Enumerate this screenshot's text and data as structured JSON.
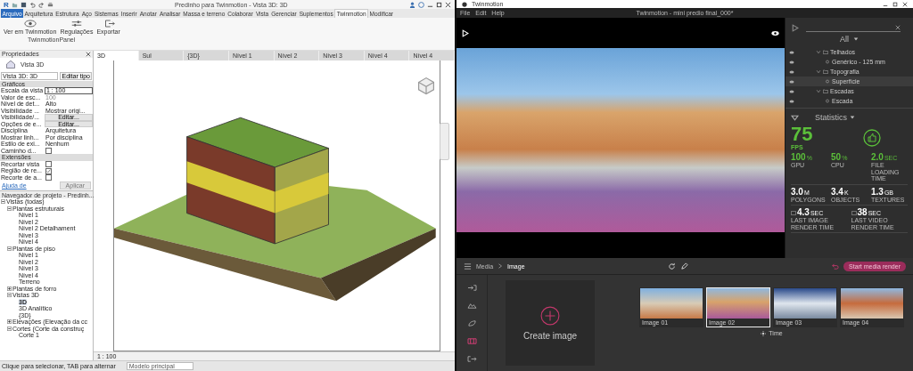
{
  "revit": {
    "logo": "R",
    "title": "Predinho para Twinmotion - Vista 3D: 3D",
    "ribbon_tabs": [
      {
        "label": "Arquivo",
        "kind": "application",
        "selected": false
      },
      {
        "label": "Arquitetura",
        "kind": "tab",
        "selected": false
      },
      {
        "label": "Estrutura",
        "kind": "tab",
        "selected": false
      },
      {
        "label": "Aço",
        "kind": "tab",
        "selected": false
      },
      {
        "label": "Sistemas",
        "kind": "tab",
        "selected": false
      },
      {
        "label": "Inserir",
        "kind": "tab",
        "selected": false
      },
      {
        "label": "Anotar",
        "kind": "tab",
        "selected": false
      },
      {
        "label": "Analisar",
        "kind": "tab",
        "selected": false
      },
      {
        "label": "Massa e terreno",
        "kind": "tab",
        "selected": false
      },
      {
        "label": "Colaborar",
        "kind": "tab",
        "selected": false
      },
      {
        "label": "Vista",
        "kind": "tab",
        "selected": false
      },
      {
        "label": "Gerenciar",
        "kind": "tab",
        "selected": false
      },
      {
        "label": "Suplementos",
        "kind": "tab",
        "selected": false
      },
      {
        "label": "Twinmotion",
        "kind": "tab",
        "selected": true
      },
      {
        "label": "Modificar",
        "kind": "tab",
        "selected": false
      }
    ],
    "ribbon_buttons": [
      {
        "label": "Ver em Twinmotion",
        "kind": "view"
      },
      {
        "label": "Regulações",
        "kind": "settings"
      },
      {
        "label": "Exportar",
        "kind": "export"
      }
    ],
    "ribbon_panel": "TwinmotionPanel",
    "properties": {
      "title": "Propriedades",
      "type_name": "Vista 3D",
      "type_selector": "Vista 3D: 3D",
      "edit_type": "Editar tipo",
      "groups": [
        {
          "name": "Gráficos",
          "rows": [
            {
              "label": "Escala da vista",
              "kind": "input",
              "value": "1 : 100"
            },
            {
              "label": "Valor de esc...",
              "kind": "readonly",
              "value": "100"
            },
            {
              "label": "Nível de det...",
              "kind": "text",
              "value": "Alto"
            },
            {
              "label": "Visibilidade ...",
              "kind": "text",
              "value": "Mostrar origi..."
            },
            {
              "label": "Visibilidade/...",
              "kind": "button",
              "value": "Editar..."
            },
            {
              "label": "Opções de e...",
              "kind": "button",
              "value": "Editar..."
            },
            {
              "label": "Disciplina",
              "kind": "text",
              "value": "Arquitetura"
            },
            {
              "label": "Mostrar linh...",
              "kind": "text",
              "value": "Por disciplina"
            },
            {
              "label": "Estilo de exi...",
              "kind": "text",
              "value": "Nenhum"
            },
            {
              "label": "Caminho d...",
              "kind": "checkbox",
              "checked": false
            }
          ]
        },
        {
          "name": "Extensões",
          "rows": [
            {
              "label": "Recortar vista",
              "kind": "checkbox",
              "checked": false
            },
            {
              "label": "Região de re...",
              "kind": "checkbox",
              "checked": true
            },
            {
              "label": "Recorte de a...",
              "kind": "checkbox",
              "checked": false
            }
          ]
        }
      ],
      "help_link": "Ajuda de",
      "apply": "Aplicar"
    },
    "browser": {
      "title": "Navegador de projeto - Predinh...",
      "tree": [
        {
          "label": "Vistas (todas)",
          "expanded": true,
          "selected": false,
          "children": [
            {
              "label": "Plantas estruturais",
              "expanded": true,
              "selected": false,
              "children": [
                {
                  "label": "Nível 1",
                  "selected": false
                },
                {
                  "label": "Nível 2",
                  "selected": false
                },
                {
                  "label": "Nível 2 Detalhament",
                  "selected": false
                },
                {
                  "label": "Nível 3",
                  "selected": false
                },
                {
                  "label": "Nível 4",
                  "selected": false
                }
              ]
            },
            {
              "label": "Plantas de piso",
              "expanded": true,
              "selected": false,
              "children": [
                {
                  "label": "Nível 1",
                  "selected": false
                },
                {
                  "label": "Nível 2",
                  "selected": false
                },
                {
                  "label": "Nível 3",
                  "selected": false
                },
                {
                  "label": "Nível 4",
                  "selected": false
                },
                {
                  "label": "Terreno",
                  "selected": false
                }
              ]
            },
            {
              "label": "Plantas de forro",
              "expanded": false,
              "selected": false
            },
            {
              "label": "Vistas 3D",
              "expanded": true,
              "selected": false,
              "children": [
                {
                  "label": "3D",
                  "selected": true
                },
                {
                  "label": "3D Analítico",
                  "selected": false
                },
                {
                  "label": "{3D}",
                  "selected": false
                }
              ]
            },
            {
              "label": "Elevações (Elevação da cc",
              "expanded": false,
              "selected": false
            },
            {
              "label": "Cortes (Corte da construç",
              "expanded": true,
              "selected": false,
              "children": [
                {
                  "label": "Corte 1",
                  "selected": false
                }
              ]
            }
          ]
        }
      ]
    },
    "view_tabs": [
      {
        "label": "3D",
        "selected": true
      },
      {
        "label": "Sul",
        "selected": false
      },
      {
        "label": "{3D}",
        "selected": false
      },
      {
        "label": "Nível 1",
        "selected": false
      },
      {
        "label": "Nível 2",
        "selected": false
      },
      {
        "label": "Nível 3",
        "selected": false
      },
      {
        "label": "Nível 4",
        "selected": false
      },
      {
        "label": "Nível 4",
        "selected": false
      }
    ],
    "view_scale": "1 : 100",
    "status": "Clique para selecionar, TAB para alternar",
    "model": "Modelo principal"
  },
  "twinmotion": {
    "os_title": "Twinmotion",
    "app_title": "Twinmotion - mini predio final_000*",
    "menu": [
      "File",
      "Edit",
      "Help"
    ],
    "scene_filter": "All",
    "scene_tree": [
      {
        "label": "Telhados",
        "expanded": true,
        "selected": false,
        "children": [
          {
            "label": "Genérico - 125 mm",
            "selected": false
          }
        ]
      },
      {
        "label": "Topografia",
        "expanded": true,
        "selected": false,
        "children": [
          {
            "label": "Superfície",
            "selected": true
          }
        ]
      },
      {
        "label": "Escadas",
        "expanded": true,
        "selected": false,
        "children": [
          {
            "label": "Escada",
            "selected": false
          }
        ]
      }
    ],
    "statistics": {
      "title": "Statistics",
      "fps": "75",
      "fps_label": "FPS",
      "rows": [
        {
          "kind": "performance",
          "items": [
            {
              "value": "100",
              "unit": "%",
              "label": "GPU"
            },
            {
              "value": "50",
              "unit": "%",
              "label": "CPU"
            },
            {
              "value": "2.0",
              "unit": "SEC",
              "label": "FILE LOADING TIME"
            }
          ]
        },
        {
          "kind": "scene",
          "items": [
            {
              "value": "3.0",
              "unit": "M",
              "label": "POLYGONS"
            },
            {
              "value": "3.4",
              "unit": "K",
              "label": "OBJECTS"
            },
            {
              "value": "1.3",
              "unit": "GB",
              "label": "TEXTURES"
            }
          ]
        },
        {
          "kind": "render",
          "items": [
            {
              "value": "4.3",
              "unit": "SEC",
              "label": "LAST IMAGE RENDER TIME"
            },
            {
              "value": "38",
              "unit": "SEC",
              "label": "LAST VIDEO RENDER TIME"
            }
          ]
        }
      ]
    },
    "breadcrumb": [
      "Media",
      "Image"
    ],
    "render_button": "Start media render",
    "tools": [
      {
        "kind": "import",
        "selected": false
      },
      {
        "kind": "terrain",
        "selected": false
      },
      {
        "kind": "nature",
        "selected": false
      },
      {
        "kind": "media",
        "selected": true
      },
      {
        "kind": "export",
        "selected": false
      }
    ],
    "create": "Create image",
    "thumbnails": [
      {
        "label": "Image 01",
        "selected": false
      },
      {
        "label": "Image 02",
        "selected": true
      },
      {
        "label": "Image 03",
        "selected": false
      },
      {
        "label": "Image 04",
        "selected": false
      }
    ],
    "time": "Time"
  }
}
